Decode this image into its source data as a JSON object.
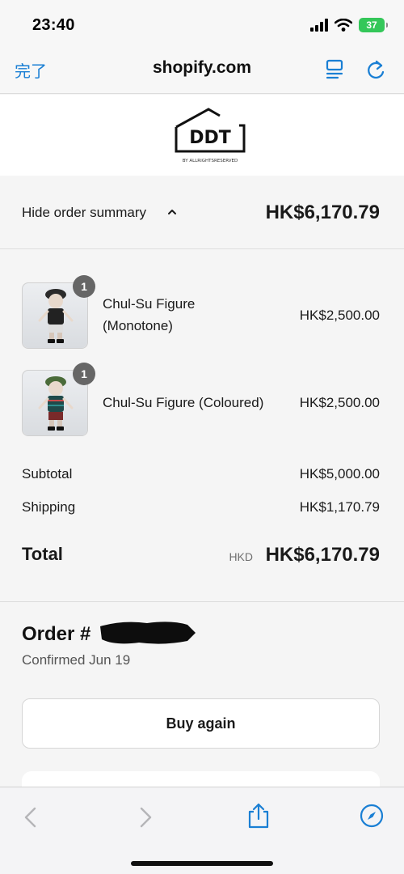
{
  "status_bar": {
    "time": "23:40",
    "battery": "37"
  },
  "browser": {
    "done_label": "完了",
    "domain": "shopify.com"
  },
  "logo": {
    "mark": "DDT",
    "tagline": "BY ALLRIGHTSRESERVED"
  },
  "summary": {
    "toggle_label": "Hide order summary",
    "total": "HK$6,170.79"
  },
  "line_items": [
    {
      "name_line1": "Chul-Su Figure",
      "name_line2": "(Monotone)",
      "price": "HK$2,500.00",
      "quantity": "1"
    },
    {
      "name": "Chul-Su Figure (Coloured)",
      "price": "HK$2,500.00",
      "quantity": "1"
    }
  ],
  "totals": {
    "subtotal_label": "Subtotal",
    "subtotal_value": "HK$5,000.00",
    "shipping_label": "Shipping",
    "shipping_value": "HK$1,170.79",
    "total_label": "Total",
    "currency": "HKD",
    "total_value": "HK$6,170.79"
  },
  "order": {
    "title": "Order #",
    "confirmed": "Confirmed Jun 19",
    "buy_again": "Buy again"
  },
  "colors": {
    "accent": "#1a7fd4",
    "badge": "#666666",
    "battery": "#34c759"
  }
}
